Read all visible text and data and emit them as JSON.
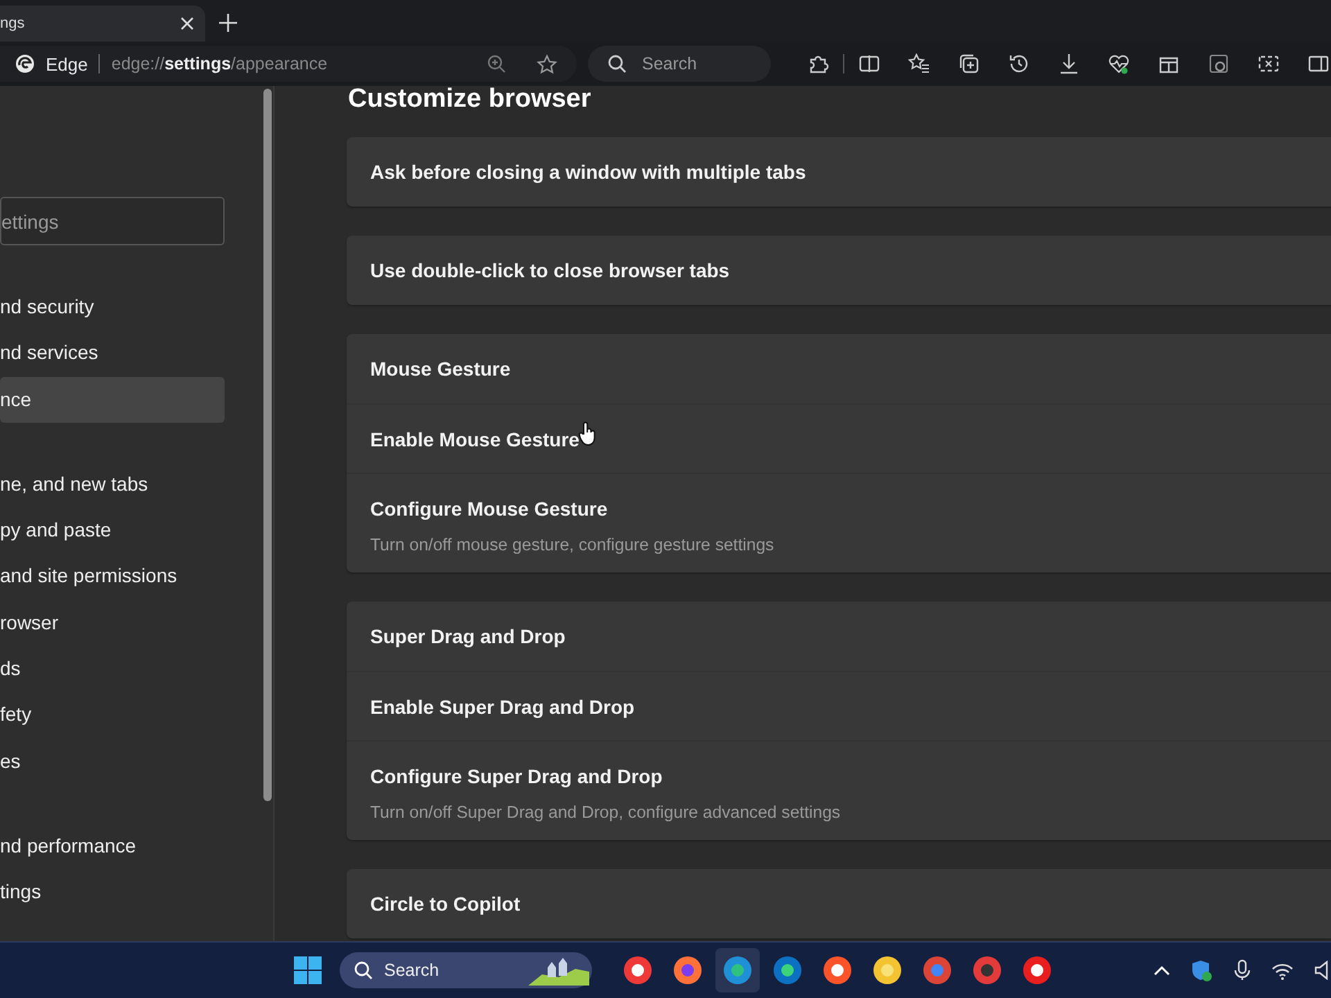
{
  "browser_tab": {
    "title": "ngs",
    "selected": true
  },
  "address_bar": {
    "site_label": "Edge",
    "url": "edge://**settings**/appearance"
  },
  "toolbar_search": {
    "placeholder": "Search"
  },
  "sidebar": {
    "search": {
      "placeholder": "ettings"
    },
    "groups": [
      [
        {
          "label": "nd security",
          "selected": false
        },
        {
          "label": "nd services",
          "selected": false
        },
        {
          "label": "nce",
          "selected": true
        }
      ],
      [
        {
          "label": "ne, and new tabs",
          "selected": false
        },
        {
          "label": "py and paste",
          "selected": false
        },
        {
          "label": "and site permissions",
          "selected": false
        },
        {
          "label": "rowser",
          "selected": false
        },
        {
          "label": "ds",
          "selected": false
        },
        {
          "label": "fety",
          "selected": false
        },
        {
          "label": "es",
          "selected": false
        }
      ],
      [
        {
          "label": "nd performance",
          "selected": false
        },
        {
          "label": "tings",
          "selected": false
        }
      ]
    ]
  },
  "content": {
    "title": "Customize browser",
    "sections": [
      [
        {
          "title": "Ask before closing a window with multiple tabs"
        }
      ],
      [
        {
          "title": "Use double-click to close browser tabs"
        }
      ],
      [
        {
          "title": "Mouse Gesture"
        },
        {
          "title": "Enable Mouse Gesture"
        },
        {
          "title": "Configure Mouse Gesture",
          "description": "Turn on/off mouse gesture, configure gesture settings"
        }
      ],
      [
        {
          "title": "Super Drag and Drop"
        },
        {
          "title": "Enable Super Drag and Drop"
        },
        {
          "title": "Configure Super Drag and Drop",
          "description": "Turn on/off Super Drag and Drop, configure advanced settings"
        }
      ],
      [
        {
          "title": "Circle to Copilot"
        }
      ]
    ]
  },
  "taskbar": {
    "search": {
      "placeholder": "Search"
    },
    "apps": [
      {
        "kind": "vivaldi",
        "active": false
      },
      {
        "kind": "firefox",
        "active": false
      },
      {
        "kind": "edge-dev",
        "active": true
      },
      {
        "kind": "edge",
        "active": false
      },
      {
        "kind": "brave",
        "active": false
      },
      {
        "kind": "canary",
        "active": false
      },
      {
        "kind": "chrome",
        "active": false
      },
      {
        "kind": "recorder",
        "active": false
      },
      {
        "kind": "music",
        "active": false
      }
    ]
  }
}
